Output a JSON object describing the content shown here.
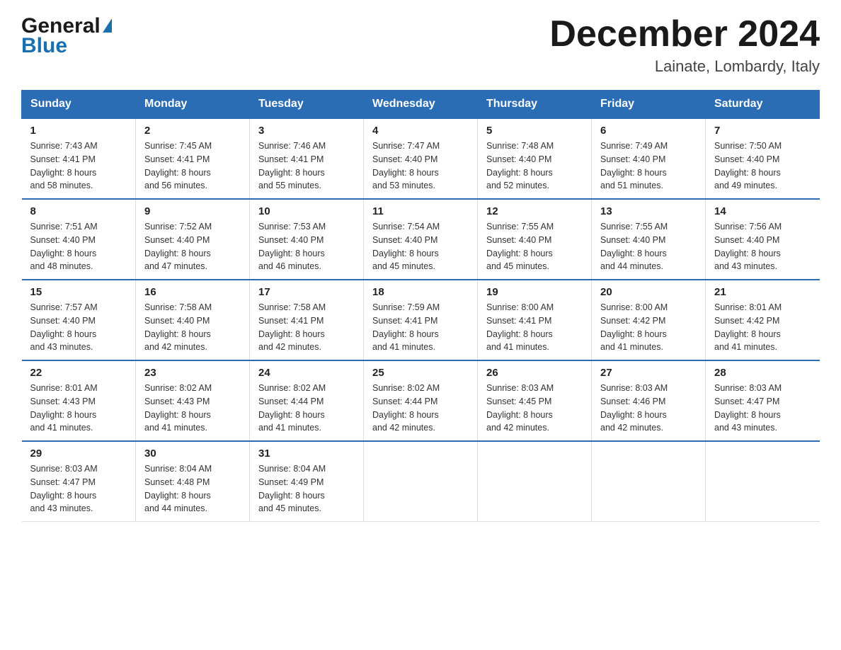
{
  "header": {
    "logo_general": "General",
    "logo_blue": "Blue",
    "month_title": "December 2024",
    "location": "Lainate, Lombardy, Italy"
  },
  "columns": [
    "Sunday",
    "Monday",
    "Tuesday",
    "Wednesday",
    "Thursday",
    "Friday",
    "Saturday"
  ],
  "weeks": [
    [
      {
        "day": "1",
        "sunrise": "7:43 AM",
        "sunset": "4:41 PM",
        "daylight": "8 hours and 58 minutes."
      },
      {
        "day": "2",
        "sunrise": "7:45 AM",
        "sunset": "4:41 PM",
        "daylight": "8 hours and 56 minutes."
      },
      {
        "day": "3",
        "sunrise": "7:46 AM",
        "sunset": "4:41 PM",
        "daylight": "8 hours and 55 minutes."
      },
      {
        "day": "4",
        "sunrise": "7:47 AM",
        "sunset": "4:40 PM",
        "daylight": "8 hours and 53 minutes."
      },
      {
        "day": "5",
        "sunrise": "7:48 AM",
        "sunset": "4:40 PM",
        "daylight": "8 hours and 52 minutes."
      },
      {
        "day": "6",
        "sunrise": "7:49 AM",
        "sunset": "4:40 PM",
        "daylight": "8 hours and 51 minutes."
      },
      {
        "day": "7",
        "sunrise": "7:50 AM",
        "sunset": "4:40 PM",
        "daylight": "8 hours and 49 minutes."
      }
    ],
    [
      {
        "day": "8",
        "sunrise": "7:51 AM",
        "sunset": "4:40 PM",
        "daylight": "8 hours and 48 minutes."
      },
      {
        "day": "9",
        "sunrise": "7:52 AM",
        "sunset": "4:40 PM",
        "daylight": "8 hours and 47 minutes."
      },
      {
        "day": "10",
        "sunrise": "7:53 AM",
        "sunset": "4:40 PM",
        "daylight": "8 hours and 46 minutes."
      },
      {
        "day": "11",
        "sunrise": "7:54 AM",
        "sunset": "4:40 PM",
        "daylight": "8 hours and 45 minutes."
      },
      {
        "day": "12",
        "sunrise": "7:55 AM",
        "sunset": "4:40 PM",
        "daylight": "8 hours and 45 minutes."
      },
      {
        "day": "13",
        "sunrise": "7:55 AM",
        "sunset": "4:40 PM",
        "daylight": "8 hours and 44 minutes."
      },
      {
        "day": "14",
        "sunrise": "7:56 AM",
        "sunset": "4:40 PM",
        "daylight": "8 hours and 43 minutes."
      }
    ],
    [
      {
        "day": "15",
        "sunrise": "7:57 AM",
        "sunset": "4:40 PM",
        "daylight": "8 hours and 43 minutes."
      },
      {
        "day": "16",
        "sunrise": "7:58 AM",
        "sunset": "4:40 PM",
        "daylight": "8 hours and 42 minutes."
      },
      {
        "day": "17",
        "sunrise": "7:58 AM",
        "sunset": "4:41 PM",
        "daylight": "8 hours and 42 minutes."
      },
      {
        "day": "18",
        "sunrise": "7:59 AM",
        "sunset": "4:41 PM",
        "daylight": "8 hours and 41 minutes."
      },
      {
        "day": "19",
        "sunrise": "8:00 AM",
        "sunset": "4:41 PM",
        "daylight": "8 hours and 41 minutes."
      },
      {
        "day": "20",
        "sunrise": "8:00 AM",
        "sunset": "4:42 PM",
        "daylight": "8 hours and 41 minutes."
      },
      {
        "day": "21",
        "sunrise": "8:01 AM",
        "sunset": "4:42 PM",
        "daylight": "8 hours and 41 minutes."
      }
    ],
    [
      {
        "day": "22",
        "sunrise": "8:01 AM",
        "sunset": "4:43 PM",
        "daylight": "8 hours and 41 minutes."
      },
      {
        "day": "23",
        "sunrise": "8:02 AM",
        "sunset": "4:43 PM",
        "daylight": "8 hours and 41 minutes."
      },
      {
        "day": "24",
        "sunrise": "8:02 AM",
        "sunset": "4:44 PM",
        "daylight": "8 hours and 41 minutes."
      },
      {
        "day": "25",
        "sunrise": "8:02 AM",
        "sunset": "4:44 PM",
        "daylight": "8 hours and 42 minutes."
      },
      {
        "day": "26",
        "sunrise": "8:03 AM",
        "sunset": "4:45 PM",
        "daylight": "8 hours and 42 minutes."
      },
      {
        "day": "27",
        "sunrise": "8:03 AM",
        "sunset": "4:46 PM",
        "daylight": "8 hours and 42 minutes."
      },
      {
        "day": "28",
        "sunrise": "8:03 AM",
        "sunset": "4:47 PM",
        "daylight": "8 hours and 43 minutes."
      }
    ],
    [
      {
        "day": "29",
        "sunrise": "8:03 AM",
        "sunset": "4:47 PM",
        "daylight": "8 hours and 43 minutes."
      },
      {
        "day": "30",
        "sunrise": "8:04 AM",
        "sunset": "4:48 PM",
        "daylight": "8 hours and 44 minutes."
      },
      {
        "day": "31",
        "sunrise": "8:04 AM",
        "sunset": "4:49 PM",
        "daylight": "8 hours and 45 minutes."
      },
      null,
      null,
      null,
      null
    ]
  ]
}
